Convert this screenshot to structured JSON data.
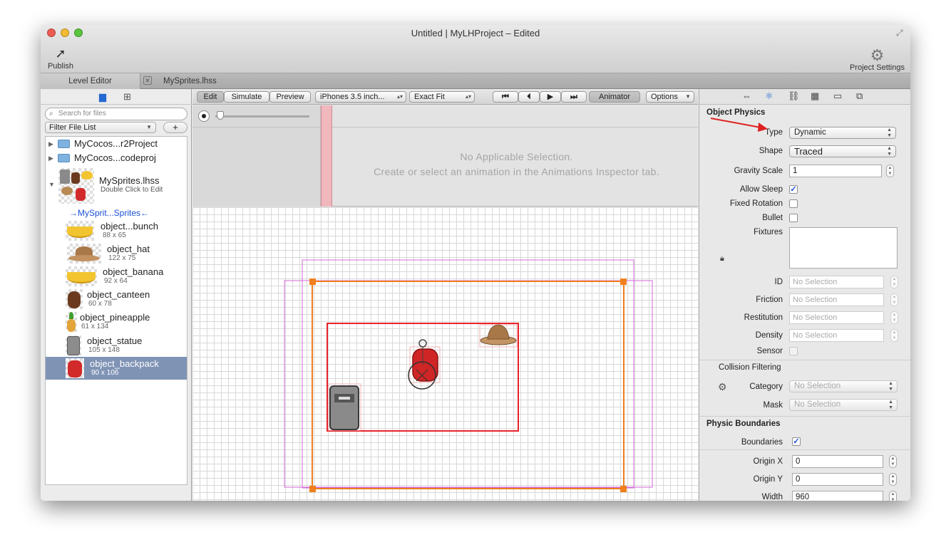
{
  "window": {
    "title": "Untitled | MyLHProject – Edited",
    "publish_label": "Publish",
    "project_settings_label": "Project Settings"
  },
  "tabs": {
    "level_editor": "Level Editor",
    "sprites_file": "MySprites.lhss"
  },
  "left_panel": {
    "search_placeholder": "Search for files",
    "filter_label": "Filter File List",
    "add_label": "+",
    "folders": [
      {
        "name": "MyCocos...r2Project"
      },
      {
        "name": "MyCocos...codeproj"
      }
    ],
    "sheet": {
      "name": "MySprites.lhss",
      "subtitle": "Double Click to Edit"
    },
    "group_label": "→MySprit...Sprites←",
    "sprites": [
      {
        "name": "object...bunch",
        "size": "88 x 65"
      },
      {
        "name": "object_hat",
        "size": "122 x 75"
      },
      {
        "name": "object_banana",
        "size": "92 x 64"
      },
      {
        "name": "object_canteen",
        "size": "60 x 78"
      },
      {
        "name": "object_pineapple",
        "size": "61 x 134"
      },
      {
        "name": "object_statue",
        "size": "105 x 148"
      },
      {
        "name": "object_backpack",
        "size": "90 x 106"
      }
    ],
    "selected_sprite": "object_backpack"
  },
  "center_toolbar": {
    "mode_tabs": [
      "Edit",
      "Simulate",
      "Preview"
    ],
    "active_mode": "Edit",
    "device": "iPhones 3.5 inch...",
    "fit": "Exact Fit",
    "animator_label": "Animator",
    "options_label": "Options"
  },
  "timeline": {
    "message_line1": "No Applicable Selection.",
    "message_line2": "Create or select an animation in the Animations Inspector tab."
  },
  "inspector": {
    "object_physics_title": "Object Physics",
    "type_label": "Type",
    "type_value": "Dynamic",
    "shape_label": "Shape",
    "shape_value": "Traced",
    "gravity_scale_label": "Gravity Scale",
    "gravity_scale_value": "1",
    "allow_sleep_label": "Allow Sleep",
    "allow_sleep_checked": true,
    "fixed_rotation_label": "Fixed Rotation",
    "bullet_label": "Bullet",
    "fixtures_label": "Fixtures",
    "id_label": "ID",
    "friction_label": "Friction",
    "restitution_label": "Restitution",
    "density_label": "Density",
    "sensor_label": "Sensor",
    "no_selection": "No Selection",
    "collision_filtering_title": "Collision Filtering",
    "category_label": "Category",
    "mask_label": "Mask",
    "physic_boundaries_title": "Physic Boundaries",
    "boundaries_label": "Boundaries",
    "boundaries_checked": true,
    "origin_x_label": "Origin X",
    "origin_x_value": "0",
    "origin_y_label": "Origin Y",
    "origin_y_value": "0",
    "width_label": "Width",
    "width_value": "960"
  },
  "colors": {
    "selection_blue": "#7f93b5",
    "boundary_orange": "#f07f1e",
    "screen_red": "#e8232b",
    "outer_magenta": "#d46ad8",
    "annotation_arrow": "#e02020"
  }
}
